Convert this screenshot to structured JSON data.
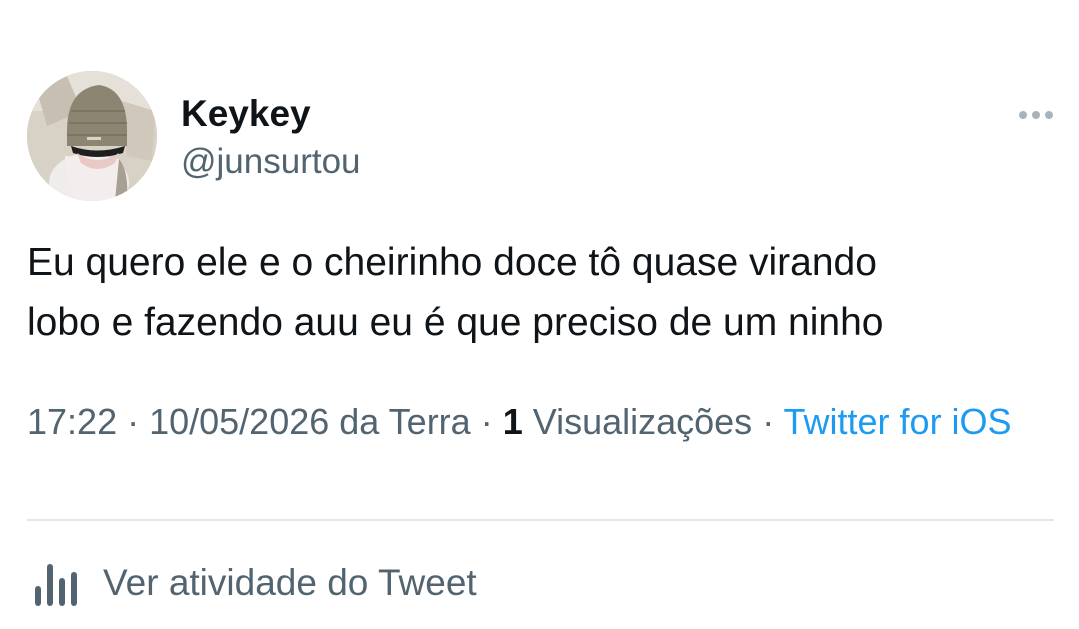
{
  "user": {
    "display_name": "Keykey",
    "handle": "@junsurtou"
  },
  "tweet": {
    "lines": [
      "Eu quero ele e o cheirinho doce tô quase virando",
      "lobo e fazendo auu eu é que preciso de um ninho"
    ]
  },
  "meta": {
    "time": "17:22",
    "separator": " · ",
    "date_place": "10/05/2026 da Terra",
    "views_count": "1",
    "views_label": " Visualizações",
    "source": "Twitter for iOS"
  },
  "activity": {
    "label": "Ver atividade do Tweet"
  },
  "colors": {
    "text_primary": "#0f1419",
    "text_secondary": "#536471",
    "link": "#1d9bf0",
    "divider": "#e1e6ea"
  },
  "icons": {
    "more": "more-horizontal-icon",
    "activity": "bar-chart-icon"
  }
}
